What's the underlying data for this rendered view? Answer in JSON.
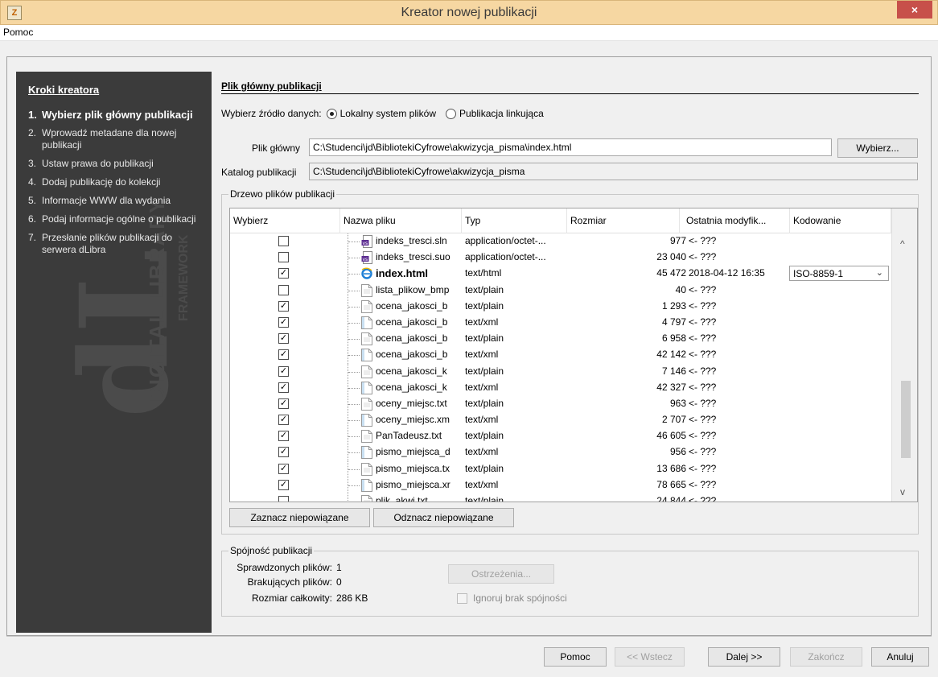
{
  "window": {
    "title": "Kreator nowej publikacji",
    "close_glyph": "×",
    "app_icon_glyph": "Z"
  },
  "menu": {
    "items": [
      "Pomoc"
    ]
  },
  "sidebar": {
    "title": "Kroki kreatora",
    "watermark_big": "dL",
    "watermark_vertical": "DIGITAL LIBRARY",
    "watermark_small": "FRAMEWORK",
    "steps": [
      {
        "num": "1.",
        "label": "Wybierz plik główny publikacji"
      },
      {
        "num": "2.",
        "label": "Wprowadź metadane dla nowej publikacji"
      },
      {
        "num": "3.",
        "label": "Ustaw prawa do publikacji"
      },
      {
        "num": "4.",
        "label": "Dodaj publikację do kolekcji"
      },
      {
        "num": "5.",
        "label": "Informacje WWW dla wydania"
      },
      {
        "num": "6.",
        "label": "Podaj informacje ogólne o publikacji"
      },
      {
        "num": "7.",
        "label": "Przesłanie plików publikacji do serwera dLibra"
      }
    ]
  },
  "main": {
    "section_title": "Plik główny publikacji",
    "source_label": "Wybierz źródło danych:",
    "source_local": "Lokalny system plików",
    "source_linked": "Publikacja linkująca",
    "main_file_label": "Plik główny",
    "main_file_value": "C:\\Studenci\\jd\\BibliotekiCyfrowe\\akwizycja_pisma\\index.html",
    "choose_button": "Wybierz...",
    "catalog_label": "Katalog publikacji",
    "catalog_value": "C:\\Studenci\\jd\\BibliotekiCyfrowe\\akwizycja_pisma"
  },
  "tree": {
    "legend": "Drzewo plików publikacji",
    "columns": [
      "Wybierz",
      "Nazwa pliku",
      "Typ",
      "Rozmiar",
      "Ostatnia modyfik...",
      "Kodowanie"
    ],
    "rows": [
      {
        "checked": false,
        "name": "indeks_tresci.sln",
        "type": "application/octet-...",
        "size": "977",
        "modified": "<- ???",
        "encoding": "",
        "icon": "vs-solution-icon"
      },
      {
        "checked": false,
        "name": "indeks_tresci.suo",
        "type": "application/octet-...",
        "size": "23 040",
        "modified": "<- ???",
        "encoding": "",
        "icon": "vs-options-icon"
      },
      {
        "checked": true,
        "name": "index.html",
        "type": "text/html",
        "size": "45 472",
        "modified": "2018-04-12 16:35",
        "encoding": "ISO-8859-1",
        "icon": "ie-browser-icon",
        "bold": true
      },
      {
        "checked": false,
        "name": "lista_plikow_bmp",
        "type": "text/plain",
        "size": "40",
        "modified": "<- ???",
        "encoding": "",
        "icon": "text-file-icon"
      },
      {
        "checked": true,
        "name": "ocena_jakosci_b",
        "type": "text/plain",
        "size": "1 293",
        "modified": "<- ???",
        "encoding": "",
        "icon": "text-file-icon"
      },
      {
        "checked": true,
        "name": "ocena_jakosci_b",
        "type": "text/xml",
        "size": "4 797",
        "modified": "<- ???",
        "encoding": "",
        "icon": "xml-file-icon"
      },
      {
        "checked": true,
        "name": "ocena_jakosci_b",
        "type": "text/plain",
        "size": "6 958",
        "modified": "<- ???",
        "encoding": "",
        "icon": "text-file-icon"
      },
      {
        "checked": true,
        "name": "ocena_jakosci_b",
        "type": "text/xml",
        "size": "42 142",
        "modified": "<- ???",
        "encoding": "",
        "icon": "xml-file-icon"
      },
      {
        "checked": true,
        "name": "ocena_jakosci_k",
        "type": "text/plain",
        "size": "7 146",
        "modified": "<- ???",
        "encoding": "",
        "icon": "text-file-icon"
      },
      {
        "checked": true,
        "name": "ocena_jakosci_k",
        "type": "text/xml",
        "size": "42 327",
        "modified": "<- ???",
        "encoding": "",
        "icon": "xml-file-icon"
      },
      {
        "checked": true,
        "name": "oceny_miejsc.txt",
        "type": "text/plain",
        "size": "963",
        "modified": "<- ???",
        "encoding": "",
        "icon": "text-file-icon"
      },
      {
        "checked": true,
        "name": "oceny_miejsc.xm",
        "type": "text/xml",
        "size": "2 707",
        "modified": "<- ???",
        "encoding": "",
        "icon": "xml-file-icon"
      },
      {
        "checked": true,
        "name": "PanTadeusz.txt",
        "type": "text/plain",
        "size": "46 605",
        "modified": "<- ???",
        "encoding": "",
        "icon": "text-file-icon"
      },
      {
        "checked": true,
        "name": "pismo_miejsca_d",
        "type": "text/xml",
        "size": "956",
        "modified": "<- ???",
        "encoding": "",
        "icon": "xml-file-icon"
      },
      {
        "checked": true,
        "name": "pismo_miejsca.tx",
        "type": "text/plain",
        "size": "13 686",
        "modified": "<- ???",
        "encoding": "",
        "icon": "text-file-icon"
      },
      {
        "checked": true,
        "name": "pismo_miejsca.xr",
        "type": "text/xml",
        "size": "78 665",
        "modified": "<- ???",
        "encoding": "",
        "icon": "xml-file-icon"
      },
      {
        "checked": false,
        "name": "plik_akwi.txt",
        "type": "text/plain",
        "size": "24 844",
        "modified": "<- ???",
        "encoding": "",
        "icon": "text-file-icon"
      }
    ],
    "select_unrelated": "Zaznacz niepowiązane",
    "deselect_unrelated": "Odznacz niepowiązane",
    "scroll_up_glyph": "^",
    "scroll_down_glyph": "v",
    "check_glyph": "✓",
    "enc_chevron_glyph": "⌄"
  },
  "consistency": {
    "legend": "Spójność publikacji",
    "checked_label": "Sprawdzonych plików:",
    "checked_value": "1",
    "missing_label": "Brakujących plików:",
    "missing_value": "0",
    "size_label": "Rozmiar całkowity:",
    "size_value": "286 KB",
    "warnings_button": "Ostrzeżenia...",
    "ignore_label": "Ignoruj brak spójności"
  },
  "footer": {
    "help": "Pomoc",
    "back": "<< Wstecz",
    "next": "Dalej >>",
    "finish": "Zakończ",
    "cancel": "Anuluj"
  }
}
